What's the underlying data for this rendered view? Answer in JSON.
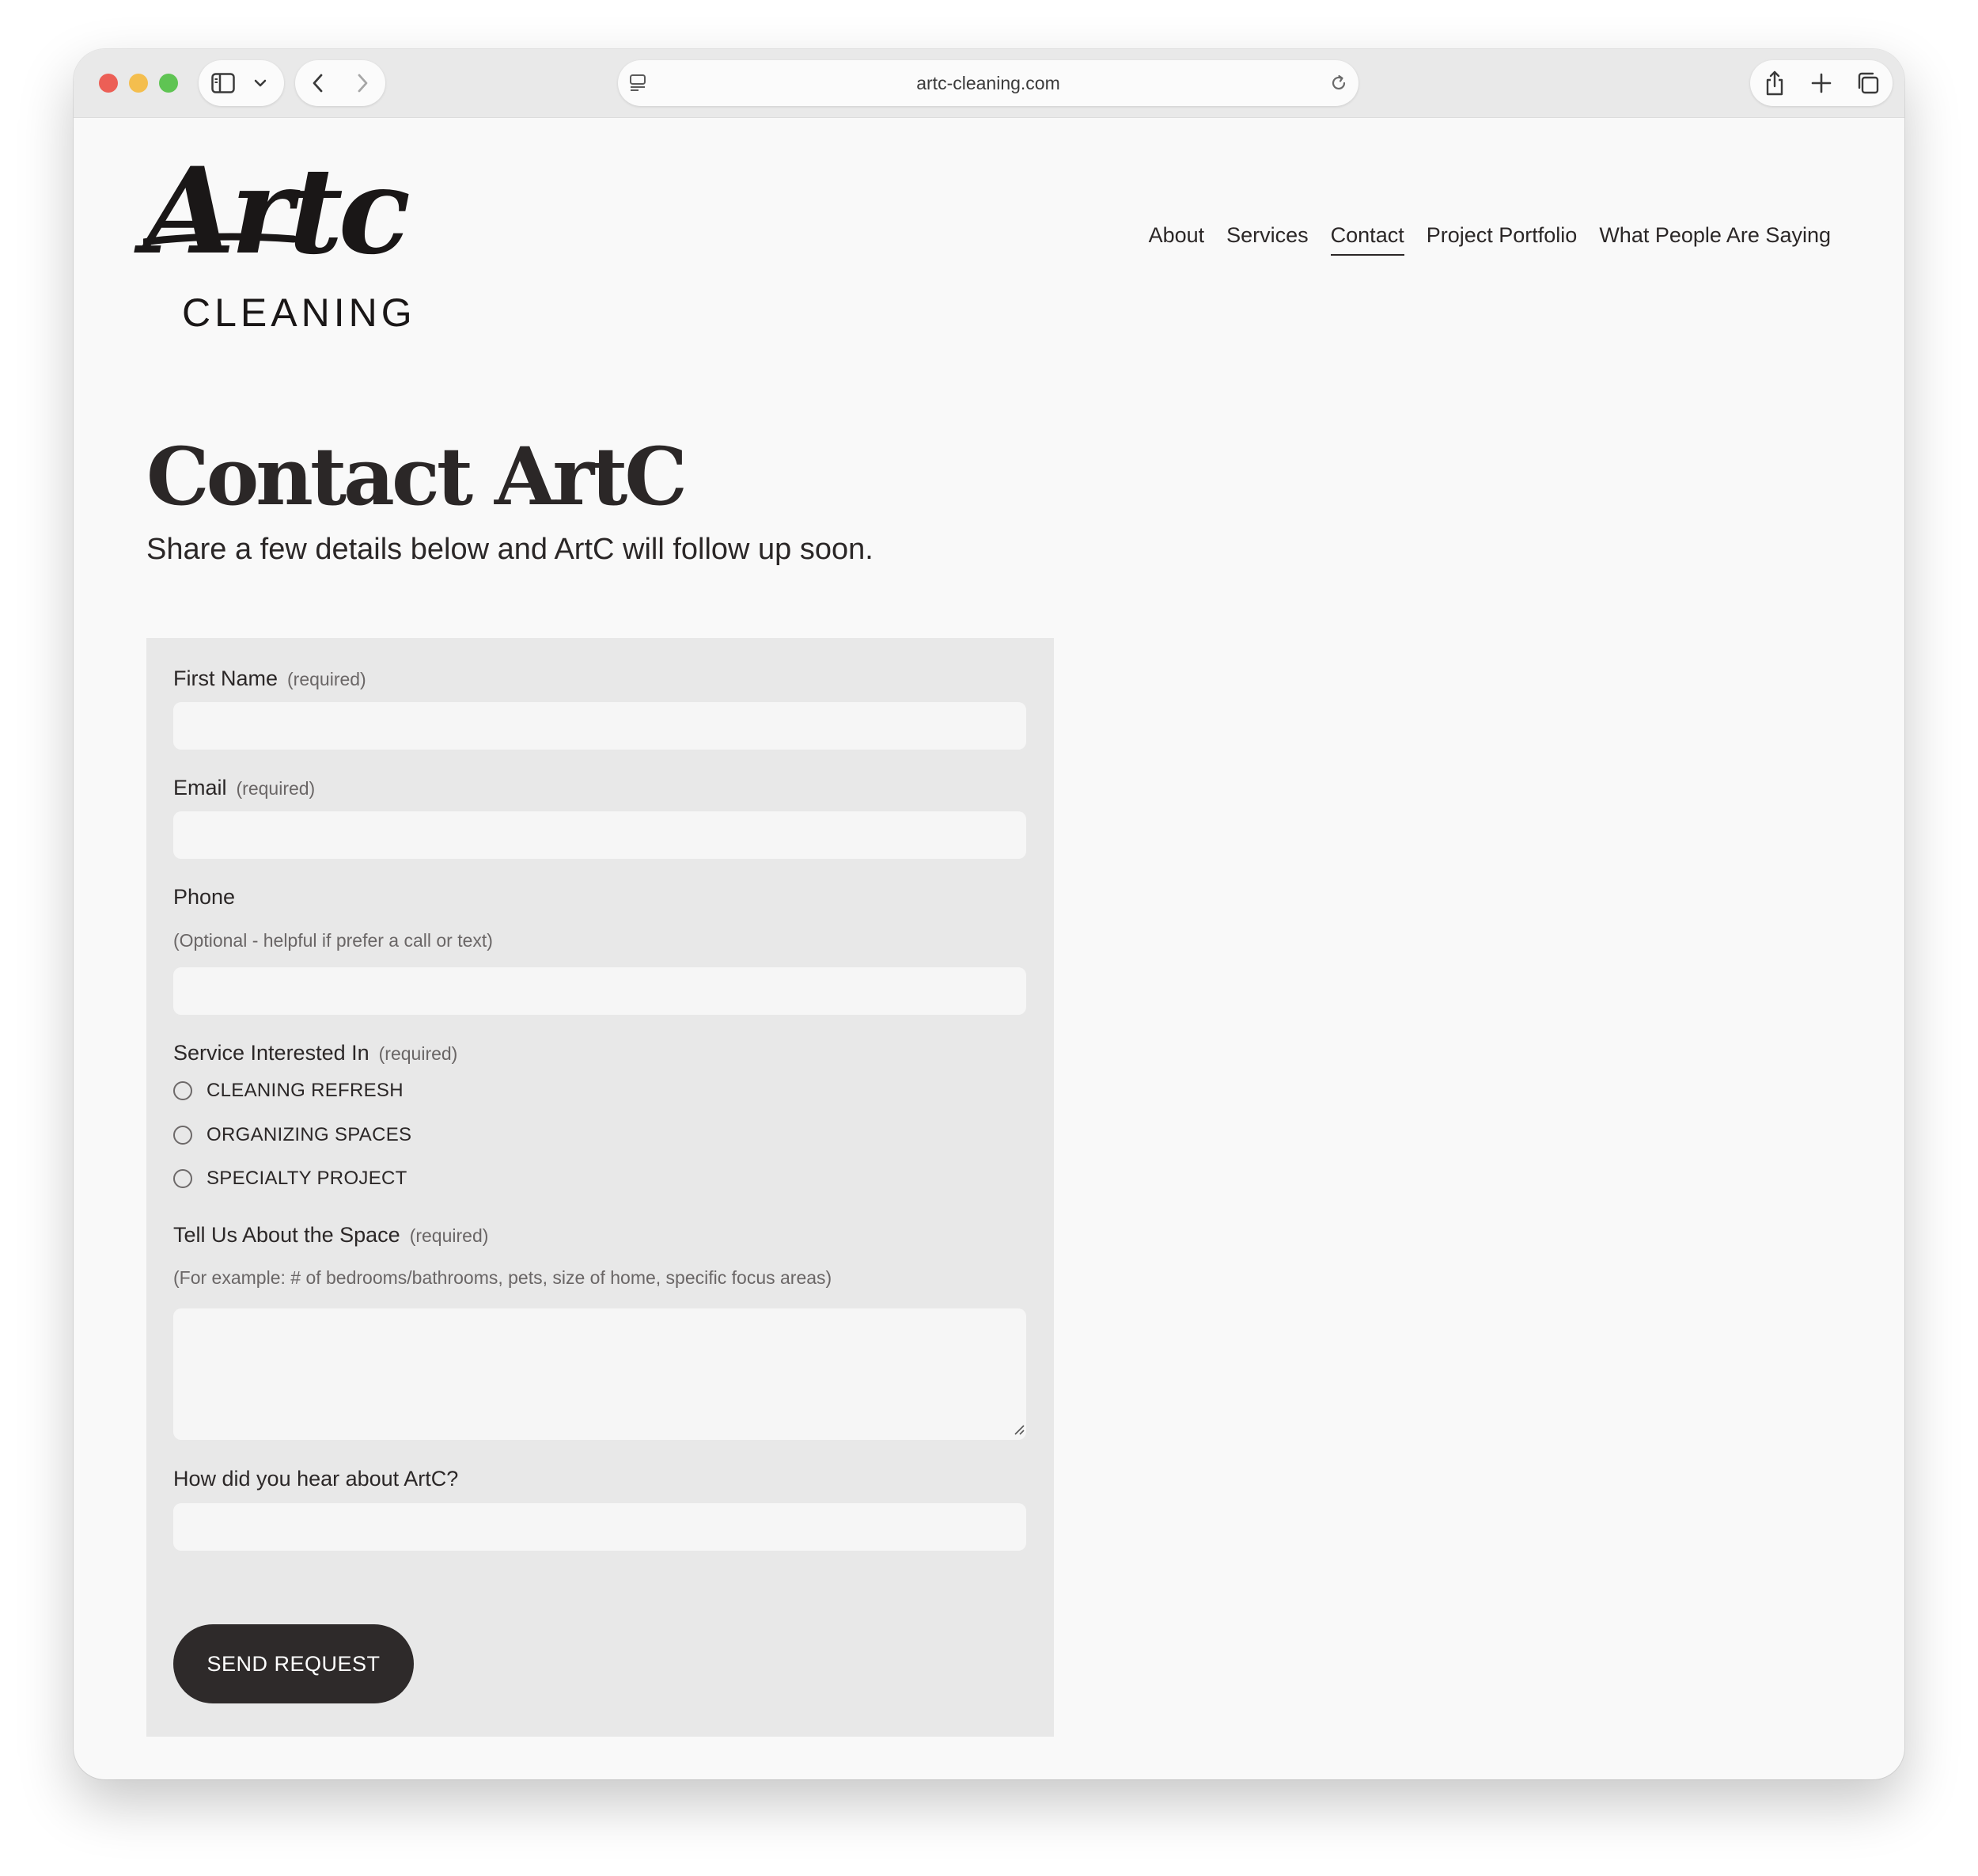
{
  "browser": {
    "url": "artc-cleaning.com"
  },
  "logo": {
    "script": "Artc",
    "sub": "CLEANING"
  },
  "nav": {
    "items": [
      {
        "label": "About"
      },
      {
        "label": "Services"
      },
      {
        "label": "Contact",
        "active": true
      },
      {
        "label": "Project Portfolio"
      },
      {
        "label": "What People Are Saying"
      }
    ]
  },
  "page": {
    "title": "Contact ArtC",
    "subtitle": "Share a few details below and ArtC will follow up soon."
  },
  "form": {
    "first_name": {
      "label": "First Name",
      "required": "(required)",
      "value": ""
    },
    "email": {
      "label": "Email",
      "required": "(required)",
      "value": ""
    },
    "phone": {
      "label": "Phone",
      "hint": "(Optional - helpful if prefer a call or text)",
      "value": ""
    },
    "service": {
      "label": "Service Interested In",
      "required": "(required)",
      "options": [
        "CLEANING REFRESH",
        "ORGANIZING SPACES",
        "SPECIALTY PROJECT"
      ]
    },
    "space": {
      "label": "Tell Us About the Space",
      "required": "(required)",
      "hint": "(For example: # of bedrooms/bathrooms, pets, size of home, specific focus areas)",
      "value": ""
    },
    "heard": {
      "label": "How did you hear about ArtC?",
      "value": ""
    },
    "submit_label": "SEND REQUEST"
  },
  "colors": {
    "page_bg": "#f9f9f9",
    "form_bg": "#e8e8e8",
    "input_bg": "#f6f6f6",
    "text": "#2b2727",
    "button_bg": "#2e2a2a"
  }
}
